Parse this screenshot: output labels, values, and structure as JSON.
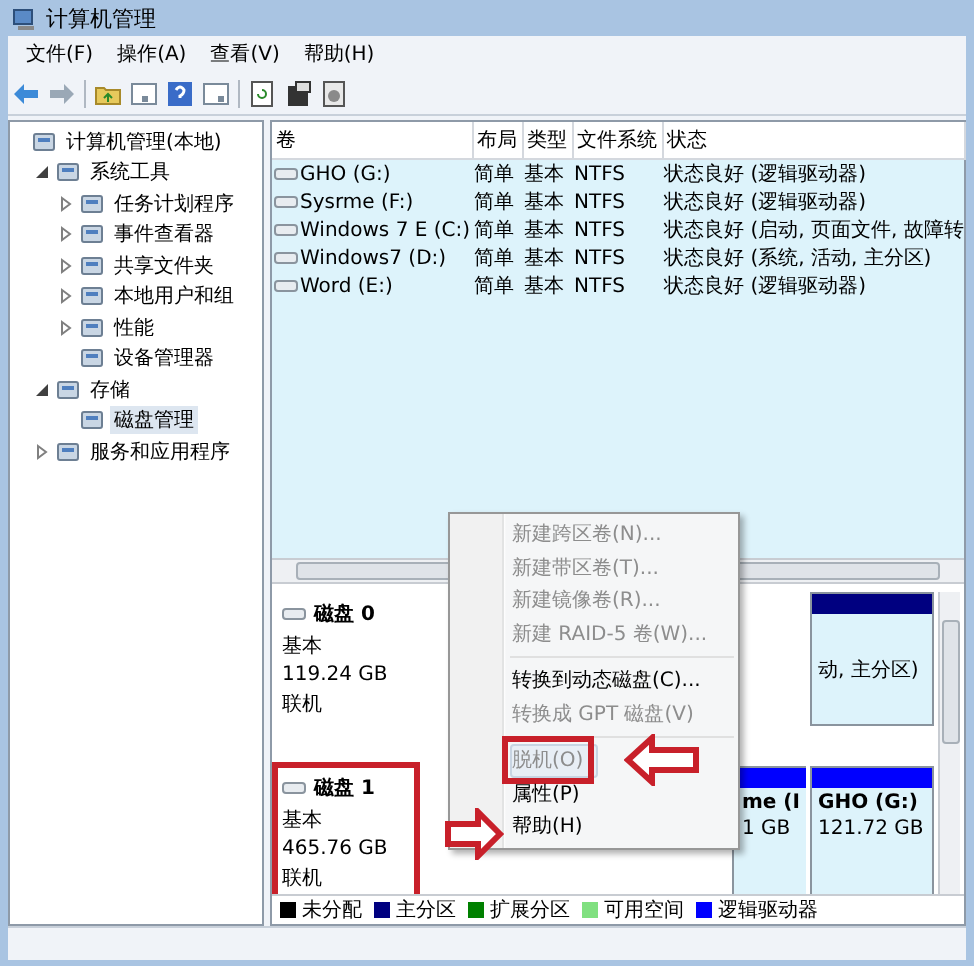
{
  "window": {
    "title": "计算机管理"
  },
  "menu_bar": [
    "文件(F)",
    "操作(A)",
    "查看(V)",
    "帮助(H)"
  ],
  "tree": [
    {
      "label": "计算机管理(本地)",
      "selected": false,
      "children": [
        {
          "label": "系统工具",
          "expanded": true,
          "selected": false,
          "children": [
            {
              "label": "任务计划程序",
              "expanded": false,
              "selected": false
            },
            {
              "label": "事件查看器",
              "expanded": false,
              "selected": false
            },
            {
              "label": "共享文件夹",
              "expanded": false,
              "selected": false
            },
            {
              "label": "本地用户和组",
              "expanded": false,
              "selected": false
            },
            {
              "label": "性能",
              "expanded": false,
              "selected": false
            },
            {
              "label": "设备管理器",
              "selected": false
            }
          ]
        },
        {
          "label": "存储",
          "expanded": true,
          "selected": false,
          "children": [
            {
              "label": "磁盘管理",
              "selected": true
            }
          ]
        },
        {
          "label": "服务和应用程序",
          "expanded": false,
          "selected": false
        }
      ]
    }
  ],
  "volume_table": {
    "columns": [
      "卷",
      "布局",
      "类型",
      "文件系统",
      "状态"
    ],
    "rows": [
      [
        "GHO (G:)",
        "简单",
        "基本",
        "NTFS",
        "状态良好 (逻辑驱动器)"
      ],
      [
        "Sysrme (F:)",
        "简单",
        "基本",
        "NTFS",
        "状态良好 (逻辑驱动器)"
      ],
      [
        "Windows 7 E (C:)",
        "简单",
        "基本",
        "NTFS",
        "状态良好 (启动, 页面文件, 故障转"
      ],
      [
        "Windows7 (D:)",
        "简单",
        "基本",
        "NTFS",
        "状态良好 (系统, 活动, 主分区)"
      ],
      [
        "Word (E:)",
        "简单",
        "基本",
        "NTFS",
        "状态良好 (逻辑驱动器)"
      ]
    ]
  },
  "disks": [
    {
      "name": "磁盘 0",
      "type": "基本",
      "size": "119.24 GB",
      "status": "联机",
      "annotated": false,
      "partitions": [
        {
          "kind": "primary",
          "status": "动, 主分区)"
        }
      ]
    },
    {
      "name": "磁盘 1",
      "type": "基本",
      "size": "465.76 GB",
      "status": "联机",
      "annotated": true,
      "partitions": [
        {
          "kind": "logical",
          "name": "me (I",
          "size": "1 GB"
        },
        {
          "kind": "logical",
          "name": "GHO (G:)",
          "size": "121.72 GB"
        }
      ]
    }
  ],
  "legend": [
    {
      "label": "未分配",
      "color": "#000000"
    },
    {
      "label": "主分区",
      "color": "#000080"
    },
    {
      "label": "扩展分区",
      "color": "#008000"
    },
    {
      "label": "可用空间",
      "color": "#80e080"
    },
    {
      "label": "逻辑驱动器",
      "color": "#0000ff"
    }
  ],
  "context_menu": [
    {
      "label": "新建跨区卷(N)...",
      "disabled": true,
      "selected": false,
      "annotated": false
    },
    {
      "label": "新建带区卷(T)...",
      "disabled": true,
      "selected": false,
      "annotated": false
    },
    {
      "label": "新建镜像卷(R)...",
      "disabled": true,
      "selected": false,
      "annotated": false
    },
    {
      "label": "新建 RAID-5 卷(W)...",
      "disabled": true,
      "selected": false,
      "annotated": false,
      "separator_after": true
    },
    {
      "label": "转换到动态磁盘(C)...",
      "disabled": false,
      "selected": false,
      "annotated": false
    },
    {
      "label": "转换成 GPT 磁盘(V)",
      "disabled": true,
      "selected": false,
      "annotated": false,
      "separator_after": true
    },
    {
      "label": "脱机(O)",
      "disabled": true,
      "selected": true,
      "annotated": true
    },
    {
      "label": "属性(P)",
      "disabled": false,
      "selected": false,
      "annotated": false
    },
    {
      "label": "帮助(H)",
      "disabled": false,
      "selected": false,
      "annotated": false
    }
  ]
}
